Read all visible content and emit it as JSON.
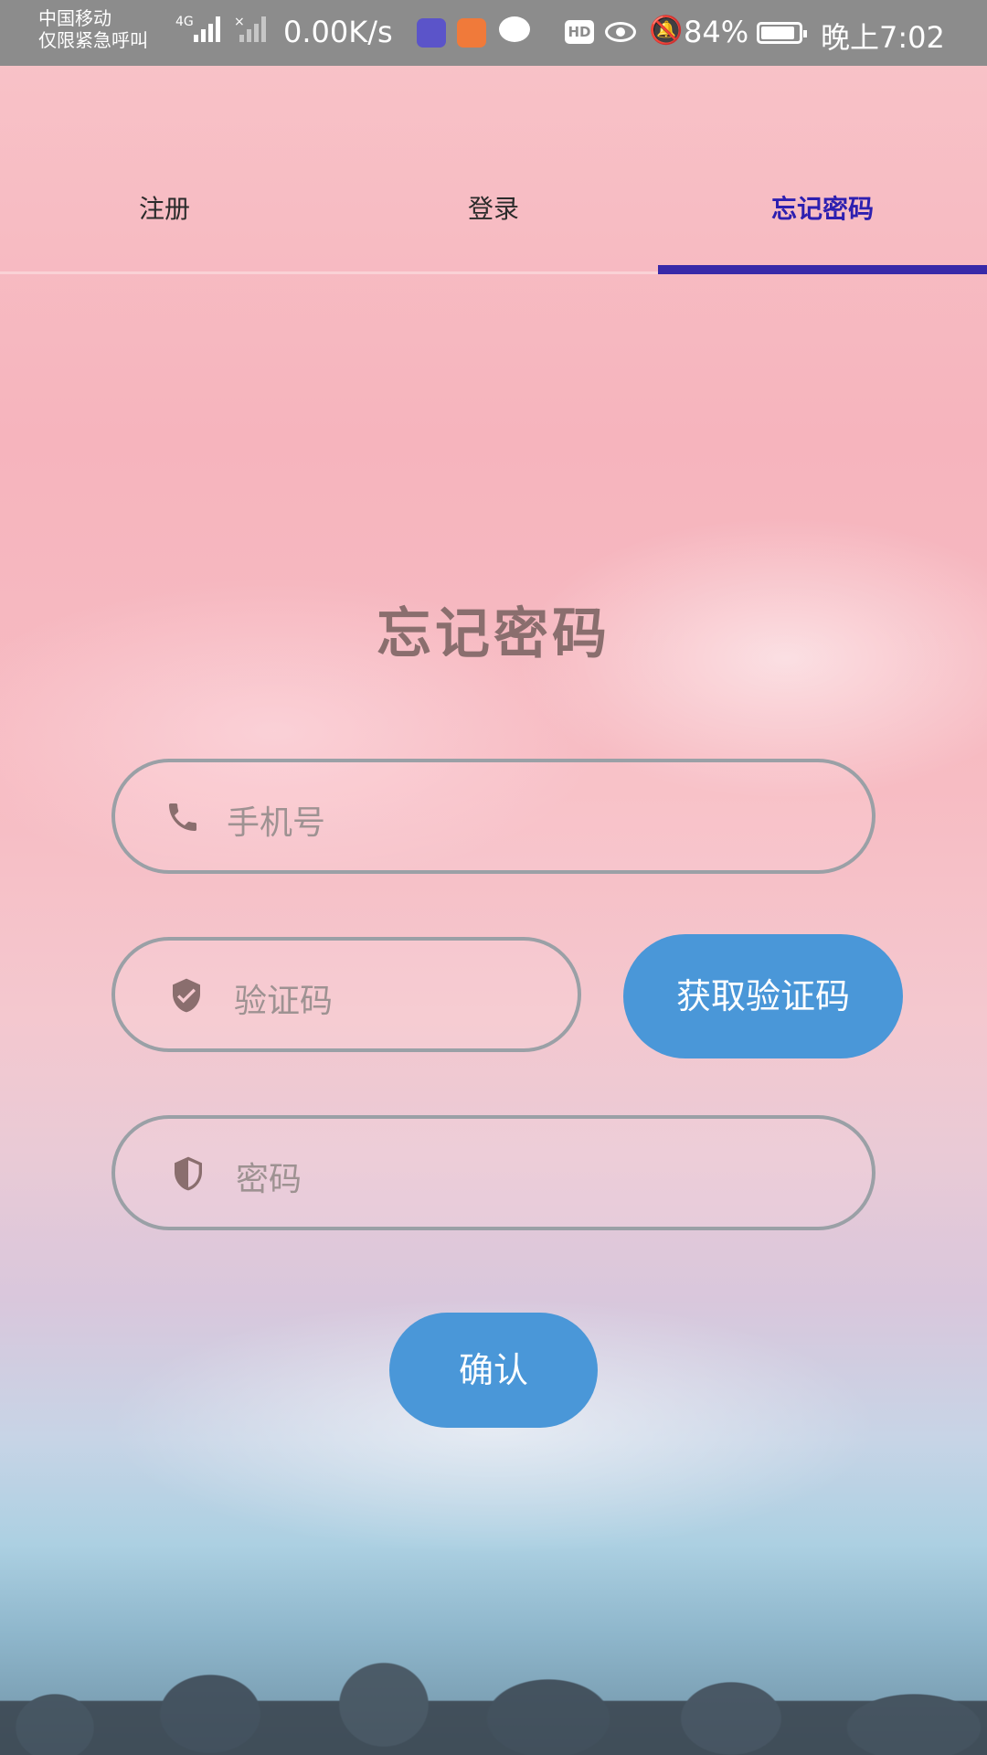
{
  "status_bar": {
    "carrier_line1": "中国移动",
    "carrier_line2": "仅限紧急呼叫",
    "network_tag": "4G",
    "no_sim_tag": "×",
    "net_speed": "0.00K/s",
    "hd_label": "HD",
    "battery_percent": "84%",
    "time": "晚上7:02"
  },
  "tabs": [
    {
      "label": "注册"
    },
    {
      "label": "登录"
    },
    {
      "label": "忘记密码",
      "active": true
    }
  ],
  "form": {
    "title": "忘记密码",
    "phone_placeholder": "手机号",
    "code_placeholder": "验证码",
    "password_placeholder": "密码",
    "get_code_button": "获取验证码",
    "confirm_button": "确认"
  },
  "colors": {
    "accent_blue": "#4a97d8",
    "tab_active": "#2d1fb0",
    "tab_indicator": "#3829a8",
    "field_border": "#9aa0a6",
    "title_color": "#8a6e6e"
  },
  "icons": {
    "phone": "phone-icon",
    "code": "shield-check-icon",
    "password": "shield-half-icon"
  }
}
